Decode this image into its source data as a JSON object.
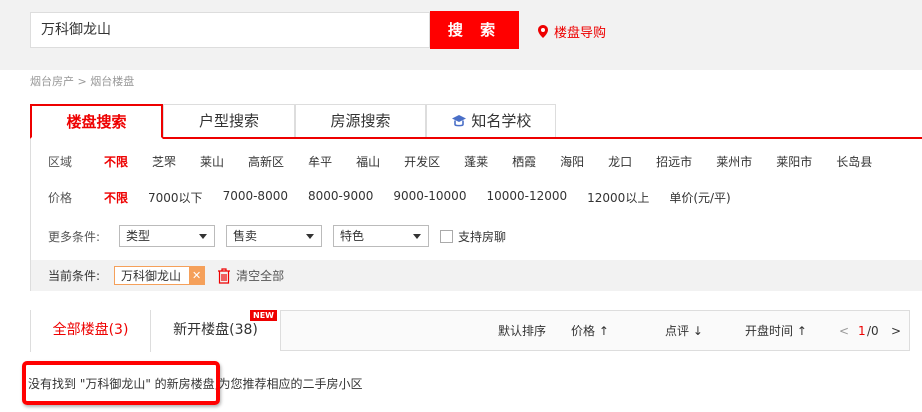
{
  "search": {
    "value": "万科御龙山",
    "button": "搜 索",
    "guide": "楼盘导购"
  },
  "breadcrumb": "烟台房产 > 烟台楼盘",
  "tabs": [
    "楼盘搜索",
    "户型搜索",
    "房源搜索",
    "知名学校"
  ],
  "region": {
    "label": "区域",
    "items": [
      "不限",
      "芝罘",
      "莱山",
      "高新区",
      "牟平",
      "福山",
      "开发区",
      "蓬莱",
      "栖霞",
      "海阳",
      "龙口",
      "招远市",
      "莱州市",
      "莱阳市",
      "长岛县"
    ]
  },
  "price": {
    "label": "价格",
    "items": [
      "不限",
      "7000以下",
      "7000-8000",
      "8000-9000",
      "9000-10000",
      "10000-12000",
      "12000以上",
      "单价(元/平)"
    ]
  },
  "more": {
    "label": "更多条件:",
    "selects": [
      "类型",
      "售卖",
      "特色"
    ],
    "checkbox": "支持房聊"
  },
  "current": {
    "label": "当前条件:",
    "tag": "万科御龙山",
    "clear": "清空全部"
  },
  "results": {
    "tabs": [
      "全部楼盘(3)",
      "新开楼盘(38)"
    ],
    "new_badge": "NEW",
    "sorts": [
      "默认排序",
      "价格 ↑",
      "点评 ↓",
      "开盘时间 ↑"
    ],
    "page_prev": "<",
    "page_current": "1",
    "page_total": "/0",
    "page_next": ">"
  },
  "message": "没有找到 \"万科御龙山\" 的新房楼盘,为您推荐相应的二手房小区",
  "colors": {
    "accent": "#ff0000",
    "tag": "#f5a05a"
  }
}
